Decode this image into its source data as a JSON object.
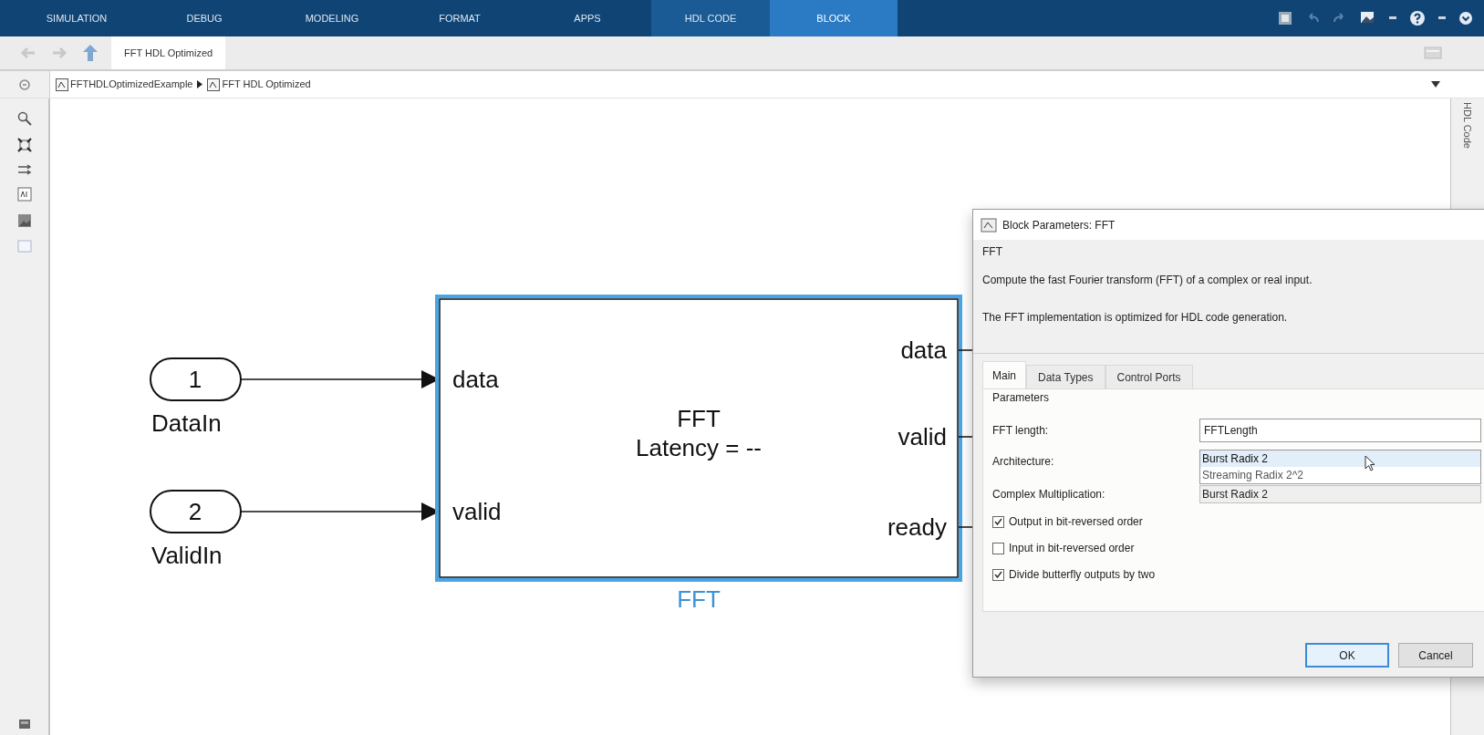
{
  "ribbon": {
    "tabs": [
      {
        "label": "SIMULATION",
        "selected": false,
        "kind": "standard"
      },
      {
        "label": "DEBUG",
        "selected": false,
        "kind": "standard"
      },
      {
        "label": "MODELING",
        "selected": false,
        "kind": "standard"
      },
      {
        "label": "FORMAT",
        "selected": false,
        "kind": "standard"
      },
      {
        "label": "APPS",
        "selected": false,
        "kind": "standard"
      },
      {
        "label": "HDL CODE",
        "selected": false,
        "kind": "contextual"
      },
      {
        "label": "BLOCK",
        "selected": true,
        "kind": "contextual"
      }
    ]
  },
  "model_tab": {
    "label": "FFT HDL Optimized"
  },
  "breadcrumb": [
    {
      "label": "FFTHDLOptimizedExample"
    },
    {
      "label": "FFT HDL Optimized"
    }
  ],
  "right_panel": {
    "label": "HDL Code"
  },
  "diagram": {
    "inports": [
      {
        "number": "1",
        "name": "DataIn"
      },
      {
        "number": "2",
        "name": "ValidIn"
      }
    ],
    "block": {
      "title": "FFT",
      "latency": "Latency = --",
      "name": "FFT",
      "selected": true,
      "inputs": [
        "data",
        "valid"
      ],
      "outputs": [
        "data",
        "valid",
        "ready"
      ]
    }
  },
  "dialog": {
    "title": "Block Parameters: FFT",
    "block_type": "FFT",
    "description": [
      "Compute the fast Fourier transform (FFT) of a complex or real input.",
      "The FFT implementation is optimized for HDL code generation."
    ],
    "tabs": [
      {
        "label": "Main",
        "selected": true
      },
      {
        "label": "Data Types",
        "selected": false
      },
      {
        "label": "Control Ports",
        "selected": false
      }
    ],
    "group": "Parameters",
    "fft_length": {
      "label": "FFT length:",
      "value": "FFTLength"
    },
    "architecture": {
      "label": "Architecture:",
      "options": [
        {
          "label": "Burst Radix 2",
          "selected": true
        },
        {
          "label": "Streaming Radix 2^2",
          "selected": false
        }
      ]
    },
    "complex_multiplication": {
      "label": "Complex Multiplication:",
      "value": "Burst Radix 2"
    },
    "checkboxes": [
      {
        "label": "Output in bit-reversed order",
        "checked": true
      },
      {
        "label": "Input in bit-reversed order",
        "checked": false
      },
      {
        "label": "Divide butterfly outputs by two",
        "checked": true
      }
    ],
    "buttons": [
      {
        "label": "OK",
        "kind": "default"
      },
      {
        "label": "Cancel",
        "kind": "normal"
      }
    ]
  }
}
